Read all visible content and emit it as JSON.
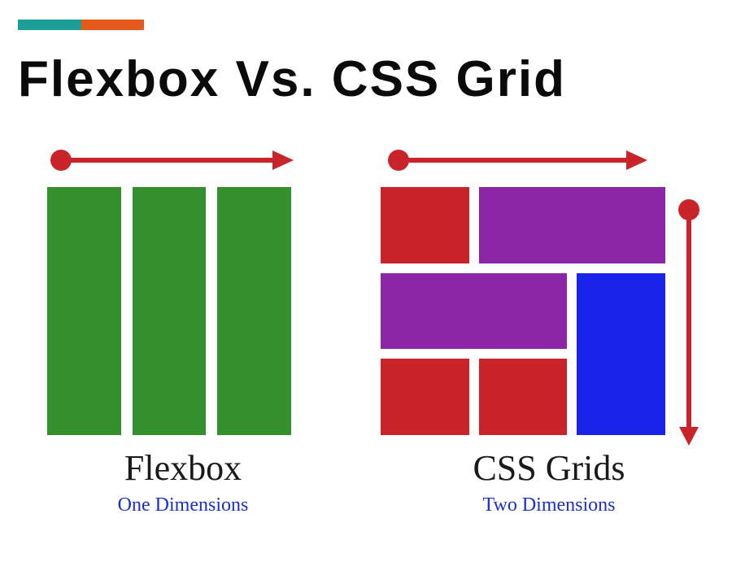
{
  "title": "Flexbox Vs. CSS Grid",
  "flexbox": {
    "label": "Flexbox",
    "sub": "One Dimensions"
  },
  "grid": {
    "label": "CSS Grids",
    "sub": "Two Dimensions"
  },
  "colors": {
    "accent_teal": "#1d9e97",
    "accent_orange": "#e55a18",
    "arrow": "#c8242a",
    "flex_box": "#33902d",
    "grid_red": "#c8242a",
    "grid_purple": "#8b27a6",
    "grid_blue": "#1a24e8",
    "subtitle": "#1a2fd0"
  }
}
